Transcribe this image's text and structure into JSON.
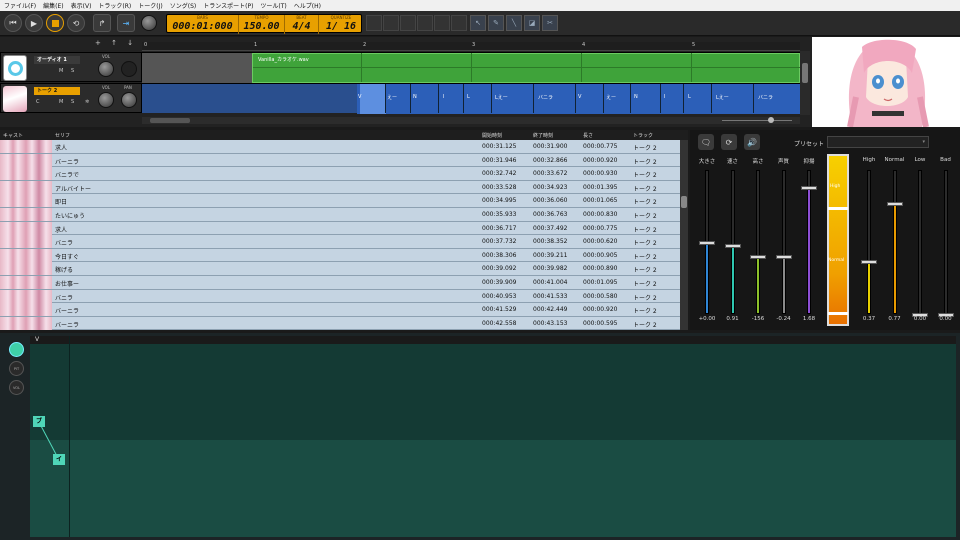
{
  "menu": [
    "ファイル(F)",
    "編集(E)",
    "表示(V)",
    "トラック(R)",
    "トーク(J)",
    "ソング(S)",
    "トランスポート(P)",
    "ツール(T)",
    "ヘルプ(H)"
  ],
  "transport": {
    "bars_label": "BARS",
    "bars": "000:01:000",
    "tempo_label": "TEMPO",
    "tempo": "150.00",
    "beat_label": "BEAT",
    "beat": "4/4",
    "quantize_label": "QUANTIZE",
    "quantize": "1/ 16"
  },
  "tracks": {
    "controls": [
      "+",
      "↑",
      "↓"
    ],
    "audio": {
      "name": "オーディオ 1",
      "m": "M",
      "s": "S",
      "vol": "VOL",
      "clip": "Vanilla_カラオケ.wav"
    },
    "talk": {
      "name": "トーク 2",
      "c": "C",
      "m": "M",
      "s": "S",
      "vol": "VOL",
      "pan": "PAN"
    },
    "ruler": [
      "0",
      "1",
      "2",
      "3",
      "4",
      "5"
    ],
    "phonemes": [
      "V",
      "えー",
      "N",
      "I",
      "L",
      "Lえー",
      "バニラ",
      "V",
      "えー",
      "N",
      "I",
      "L",
      "Lえー",
      "バニラ"
    ]
  },
  "list": {
    "headers": {
      "cast": "キャスト",
      "serif": "セリフ",
      "start": "開始時刻",
      "end": "終了時刻",
      "length": "長さ",
      "track": "トラック"
    },
    "rows": [
      {
        "serif": "求人",
        "start": "000:31.125",
        "end": "000:31.900",
        "length": "000:00.775",
        "track": "トーク 2"
      },
      {
        "serif": "バーニラ",
        "start": "000:31.946",
        "end": "000:32.866",
        "length": "000:00.920",
        "track": "トーク 2"
      },
      {
        "serif": "バニラで",
        "start": "000:32.742",
        "end": "000:33.672",
        "length": "000:00.930",
        "track": "トーク 2"
      },
      {
        "serif": "アルバイトー",
        "start": "000:33.528",
        "end": "000:34.923",
        "length": "000:01.395",
        "track": "トーク 2"
      },
      {
        "serif": "即日",
        "start": "000:34.995",
        "end": "000:36.060",
        "length": "000:01.065",
        "track": "トーク 2"
      },
      {
        "serif": "たいにゅう",
        "start": "000:35.933",
        "end": "000:36.763",
        "length": "000:00.830",
        "track": "トーク 2"
      },
      {
        "serif": "求人",
        "start": "000:36.717",
        "end": "000:37.492",
        "length": "000:00.775",
        "track": "トーク 2"
      },
      {
        "serif": "バニラ",
        "start": "000:37.732",
        "end": "000:38.352",
        "length": "000:00.620",
        "track": "トーク 2"
      },
      {
        "serif": "今日すぐ",
        "start": "000:38.306",
        "end": "000:39.211",
        "length": "000:00.905",
        "track": "トーク 2"
      },
      {
        "serif": "稼げる",
        "start": "000:39.092",
        "end": "000:39.982",
        "length": "000:00.890",
        "track": "トーク 2"
      },
      {
        "serif": "お仕事ー",
        "start": "000:39.909",
        "end": "000:41.004",
        "length": "000:01.095",
        "track": "トーク 2"
      },
      {
        "serif": "バニラ",
        "start": "000:40.953",
        "end": "000:41.533",
        "length": "000:00.580",
        "track": "トーク 2"
      },
      {
        "serif": "バーニラ",
        "start": "000:41.529",
        "end": "000:42.449",
        "length": "000:00.920",
        "track": "トーク 2"
      },
      {
        "serif": "バーニラ",
        "start": "000:42.558",
        "end": "000:43.153",
        "length": "000:00.595",
        "track": "トーク 2"
      }
    ]
  },
  "params": {
    "preset_label": "プリセット",
    "sliders": [
      {
        "label": "大きさ",
        "value": "+0.00",
        "level": 0.5,
        "color": "#2f86d6"
      },
      {
        "label": "速さ",
        "value": "0.91",
        "level": 0.48,
        "color": "#2fc7b0"
      },
      {
        "label": "高さ",
        "value": "-156",
        "level": 0.4,
        "color": "#8cc02a"
      },
      {
        "label": "声質",
        "value": "-0.24",
        "level": 0.4,
        "color": "#8a8a8a"
      },
      {
        "label": "抑揚",
        "value": "1.68",
        "level": 0.88,
        "color": "#8d4fd6"
      }
    ],
    "intonation": {
      "high": "High",
      "normal": "Normal"
    },
    "emotions": [
      {
        "label": "High",
        "value": "0.37",
        "level": 0.37,
        "color": "#e8d000"
      },
      {
        "label": "Normal",
        "value": "0.77",
        "level": 0.77,
        "color": "#e89a00"
      },
      {
        "label": "Low",
        "value": "0.00",
        "level": 0,
        "color": "#888"
      },
      {
        "label": "Bad",
        "value": "0.00",
        "level": 0,
        "color": "#888"
      }
    ]
  },
  "editor": {
    "side": [
      "",
      "PIT",
      "VOL"
    ],
    "marker": "V",
    "notes": [
      "ブ",
      "イ"
    ]
  },
  "colors": {
    "accent": "#e8a000",
    "audio_clip": "#3fa33a",
    "talk_clip": "#2c5fb8",
    "list_bg": "#c5d4e2"
  }
}
